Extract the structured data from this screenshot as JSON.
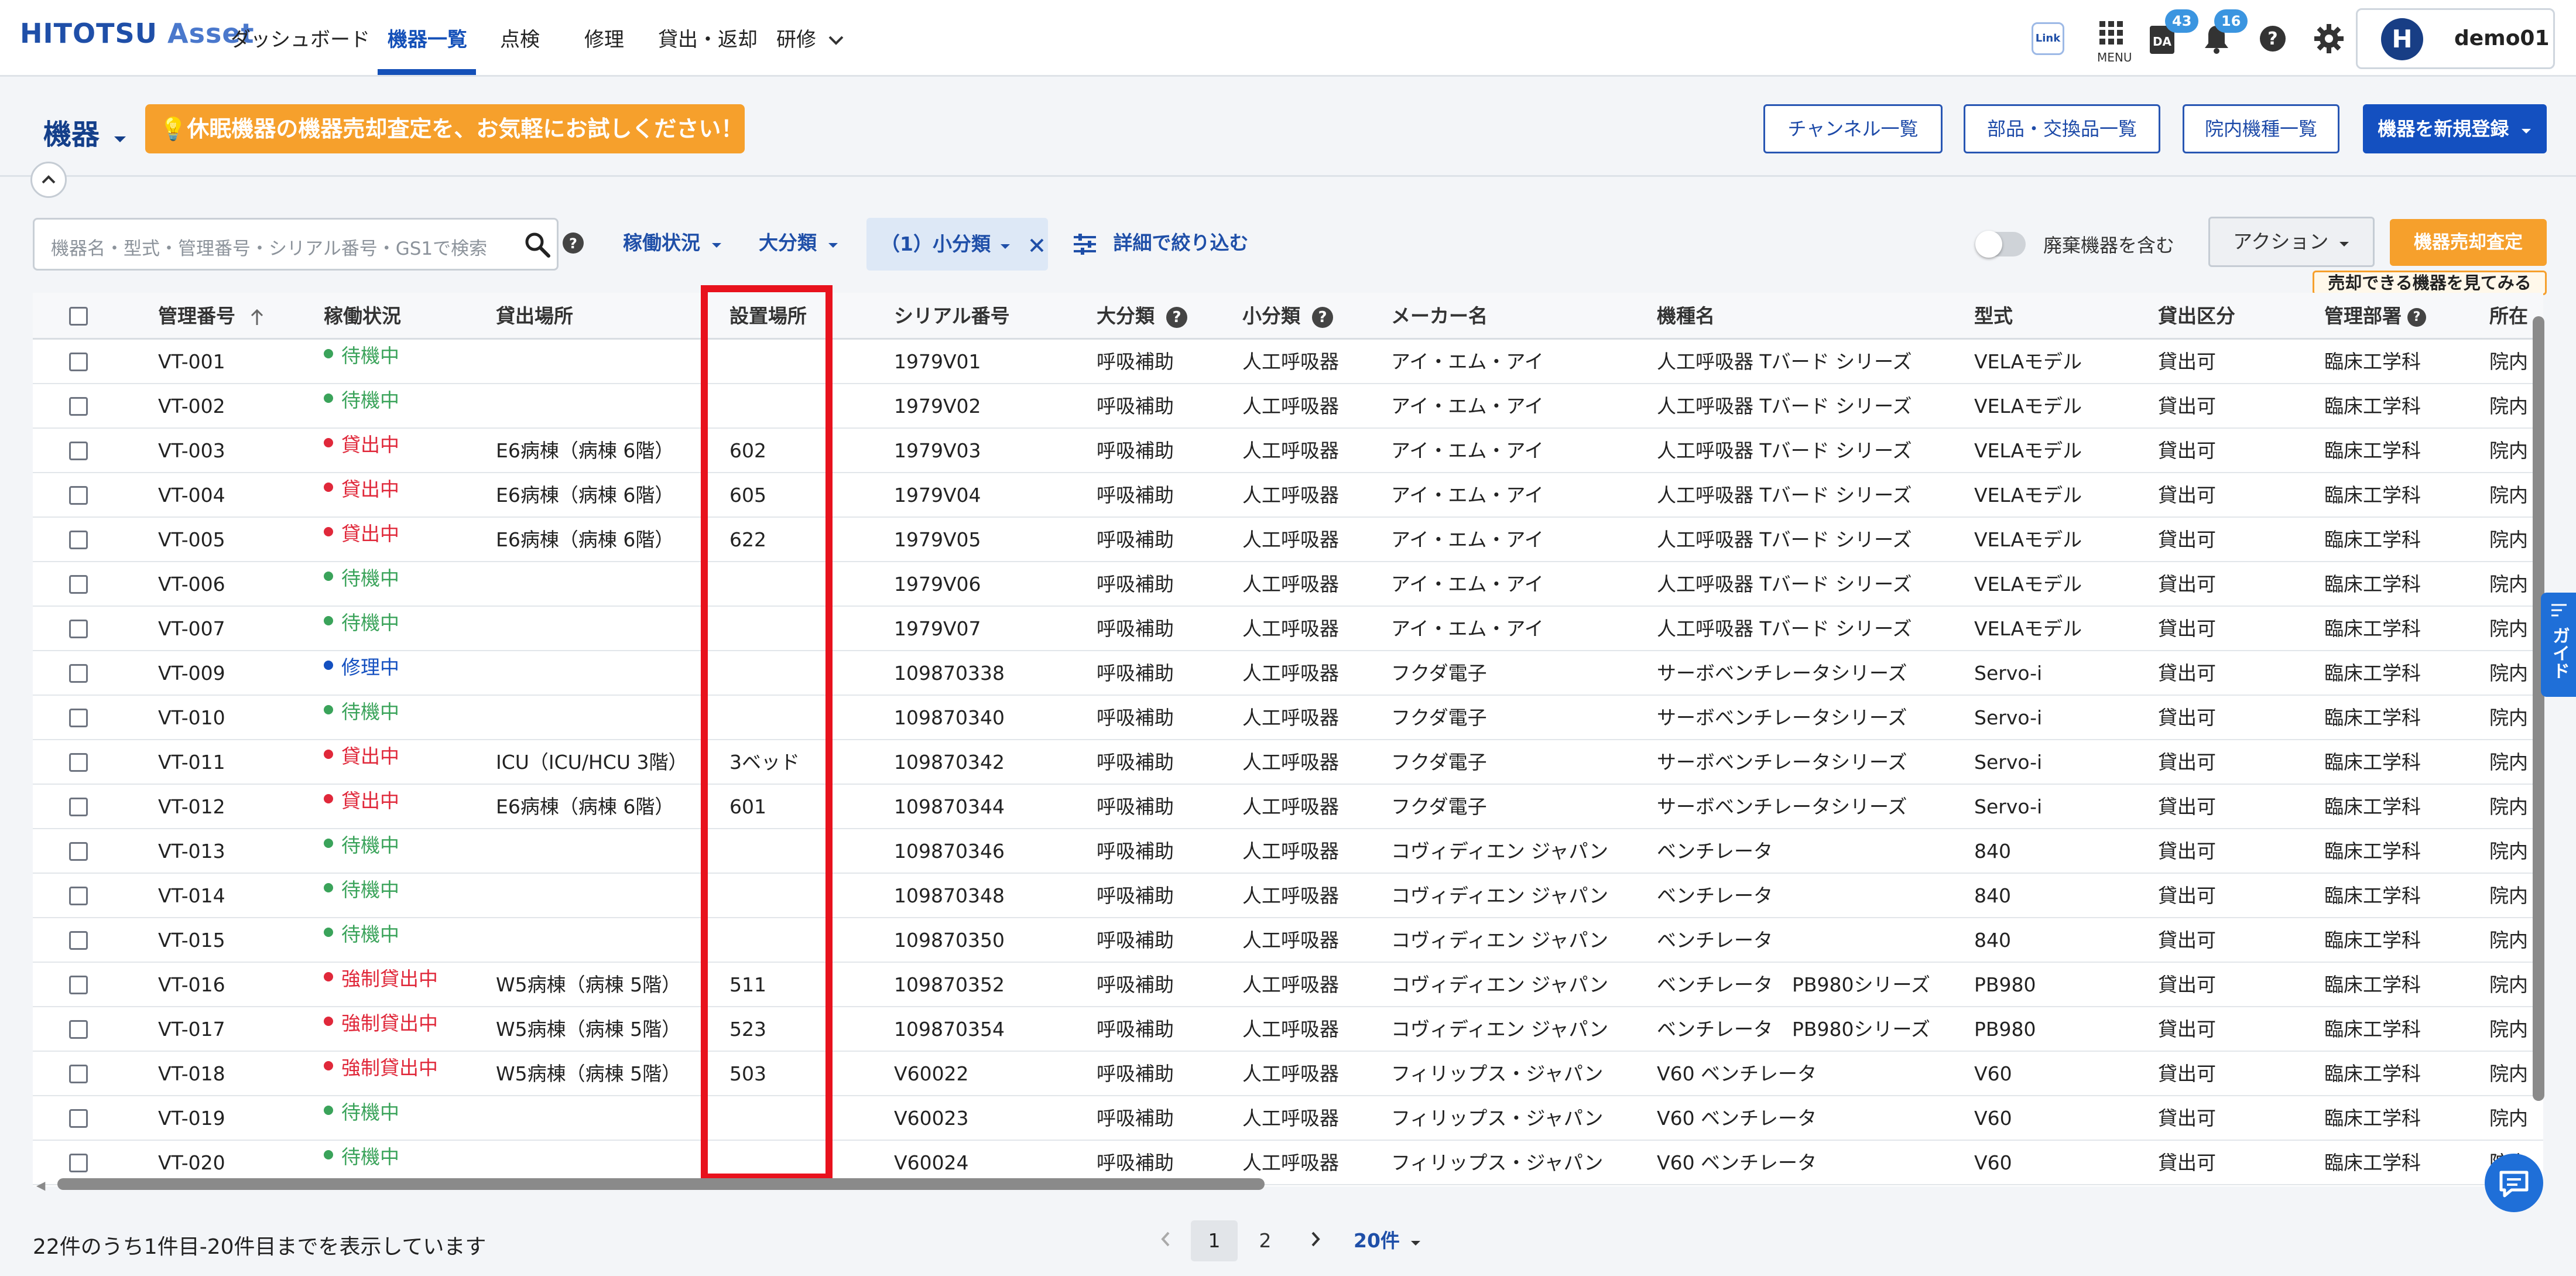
{
  "nav": {
    "logo_main": "HITOTSU",
    "logo_sub": "Asset",
    "items": [
      "ダッシュボード",
      "機器一覧",
      "点検",
      "修理",
      "貸出・返却",
      "研修"
    ],
    "link_label": "Link",
    "menu_label": "MENU",
    "da_badge": "43",
    "bell_badge": "16",
    "user_initial": "H",
    "username": "demo01"
  },
  "subheader": {
    "title": "機器",
    "promo": "💡休眠機器の機器売却査定を、お気軽にお試しください！",
    "buttons": [
      "チャンネル一覧",
      "部品・交換品一覧",
      "院内機種一覧"
    ],
    "primary_button": "機器を新規登録"
  },
  "filters": {
    "search_placeholder": "機器名・型式・管理番号・シリアル番号・GS1で検索",
    "status_filter": "稼働状況",
    "category_filter": "大分類",
    "subcategory_chip": "（1）小分類",
    "detail_filter": "詳細で絞り込む",
    "toggle_label": "廃棄機器を含む",
    "action_button": "アクション",
    "sale_button": "機器売却査定",
    "sale_tip": "売却できる機器を見てみる"
  },
  "table": {
    "columns": [
      "管理番号",
      "稼働状況",
      "貸出場所",
      "設置場所",
      "シリアル番号",
      "大分類",
      "小分類",
      "メーカー名",
      "機種名",
      "型式",
      "貸出区分",
      "管理部署",
      "所在"
    ],
    "rows": [
      [
        "VT-001",
        "待機中",
        "",
        "",
        "1979V01",
        "呼吸補助",
        "人工呼吸器",
        "アイ・エム・アイ",
        "人工呼吸器 Tバード シリーズ",
        "VELAモデル",
        "貸出可",
        "臨床工学科",
        "院内"
      ],
      [
        "VT-002",
        "待機中",
        "",
        "",
        "1979V02",
        "呼吸補助",
        "人工呼吸器",
        "アイ・エム・アイ",
        "人工呼吸器 Tバード シリーズ",
        "VELAモデル",
        "貸出可",
        "臨床工学科",
        "院内"
      ],
      [
        "VT-003",
        "貸出中",
        "E6病棟（病棟 6階）",
        "602",
        "1979V03",
        "呼吸補助",
        "人工呼吸器",
        "アイ・エム・アイ",
        "人工呼吸器 Tバード シリーズ",
        "VELAモデル",
        "貸出可",
        "臨床工学科",
        "院内"
      ],
      [
        "VT-004",
        "貸出中",
        "E6病棟（病棟 6階）",
        "605",
        "1979V04",
        "呼吸補助",
        "人工呼吸器",
        "アイ・エム・アイ",
        "人工呼吸器 Tバード シリーズ",
        "VELAモデル",
        "貸出可",
        "臨床工学科",
        "院内"
      ],
      [
        "VT-005",
        "貸出中",
        "E6病棟（病棟 6階）",
        "622",
        "1979V05",
        "呼吸補助",
        "人工呼吸器",
        "アイ・エム・アイ",
        "人工呼吸器 Tバード シリーズ",
        "VELAモデル",
        "貸出可",
        "臨床工学科",
        "院内"
      ],
      [
        "VT-006",
        "待機中",
        "",
        "",
        "1979V06",
        "呼吸補助",
        "人工呼吸器",
        "アイ・エム・アイ",
        "人工呼吸器 Tバード シリーズ",
        "VELAモデル",
        "貸出可",
        "臨床工学科",
        "院内"
      ],
      [
        "VT-007",
        "待機中",
        "",
        "",
        "1979V07",
        "呼吸補助",
        "人工呼吸器",
        "アイ・エム・アイ",
        "人工呼吸器 Tバード シリーズ",
        "VELAモデル",
        "貸出可",
        "臨床工学科",
        "院内"
      ],
      [
        "VT-009",
        "修理中",
        "",
        "",
        "109870338",
        "呼吸補助",
        "人工呼吸器",
        "フクダ電子",
        "サーボベンチレータシリーズ",
        "Servo-i",
        "貸出可",
        "臨床工学科",
        "院内"
      ],
      [
        "VT-010",
        "待機中",
        "",
        "",
        "109870340",
        "呼吸補助",
        "人工呼吸器",
        "フクダ電子",
        "サーボベンチレータシリーズ",
        "Servo-i",
        "貸出可",
        "臨床工学科",
        "院内"
      ],
      [
        "VT-011",
        "貸出中",
        "ICU（ICU/HCU 3階）",
        "3ベッド",
        "109870342",
        "呼吸補助",
        "人工呼吸器",
        "フクダ電子",
        "サーボベンチレータシリーズ",
        "Servo-i",
        "貸出可",
        "臨床工学科",
        "院内"
      ],
      [
        "VT-012",
        "貸出中",
        "E6病棟（病棟 6階）",
        "601",
        "109870344",
        "呼吸補助",
        "人工呼吸器",
        "フクダ電子",
        "サーボベンチレータシリーズ",
        "Servo-i",
        "貸出可",
        "臨床工学科",
        "院内"
      ],
      [
        "VT-013",
        "待機中",
        "",
        "",
        "109870346",
        "呼吸補助",
        "人工呼吸器",
        "コヴィディエン ジャパン",
        "ベンチレータ",
        "840",
        "貸出可",
        "臨床工学科",
        "院内"
      ],
      [
        "VT-014",
        "待機中",
        "",
        "",
        "109870348",
        "呼吸補助",
        "人工呼吸器",
        "コヴィディエン ジャパン",
        "ベンチレータ",
        "840",
        "貸出可",
        "臨床工学科",
        "院内"
      ],
      [
        "VT-015",
        "待機中",
        "",
        "",
        "109870350",
        "呼吸補助",
        "人工呼吸器",
        "コヴィディエン ジャパン",
        "ベンチレータ",
        "840",
        "貸出可",
        "臨床工学科",
        "院内"
      ],
      [
        "VT-016",
        "強制貸出中",
        "W5病棟（病棟 5階）",
        "511",
        "109870352",
        "呼吸補助",
        "人工呼吸器",
        "コヴィディエン ジャパン",
        "ベンチレータ　PB980シリーズ",
        "PB980",
        "貸出可",
        "臨床工学科",
        "院内"
      ],
      [
        "VT-017",
        "強制貸出中",
        "W5病棟（病棟 5階）",
        "523",
        "109870354",
        "呼吸補助",
        "人工呼吸器",
        "コヴィディエン ジャパン",
        "ベンチレータ　PB980シリーズ",
        "PB980",
        "貸出可",
        "臨床工学科",
        "院内"
      ],
      [
        "VT-018",
        "強制貸出中",
        "W5病棟（病棟 5階）",
        "503",
        "V60022",
        "呼吸補助",
        "人工呼吸器",
        "フィリップス・ジャパン",
        "V60 ベンチレータ",
        "V60",
        "貸出可",
        "臨床工学科",
        "院内"
      ],
      [
        "VT-019",
        "待機中",
        "",
        "",
        "V60023",
        "呼吸補助",
        "人工呼吸器",
        "フィリップス・ジャパン",
        "V60 ベンチレータ",
        "V60",
        "貸出可",
        "臨床工学科",
        "院内"
      ],
      [
        "VT-020",
        "待機中",
        "",
        "",
        "V60024",
        "呼吸補助",
        "人工呼吸器",
        "フィリップス・ジャパン",
        "V60 ベンチレータ",
        "V60",
        "貸出可",
        "臨床工学科",
        "院内"
      ]
    ]
  },
  "status_colors": {
    "待機中": "#3aa35a",
    "貸出中": "#e0283a",
    "修理中": "#1450c0",
    "強制貸出中": "#e0283a"
  },
  "guide_label": "ガイド",
  "footer": {
    "summary": "22件のうち1件目-20件目までを表示しています",
    "pages": [
      "1",
      "2"
    ],
    "page_size": "20件"
  }
}
